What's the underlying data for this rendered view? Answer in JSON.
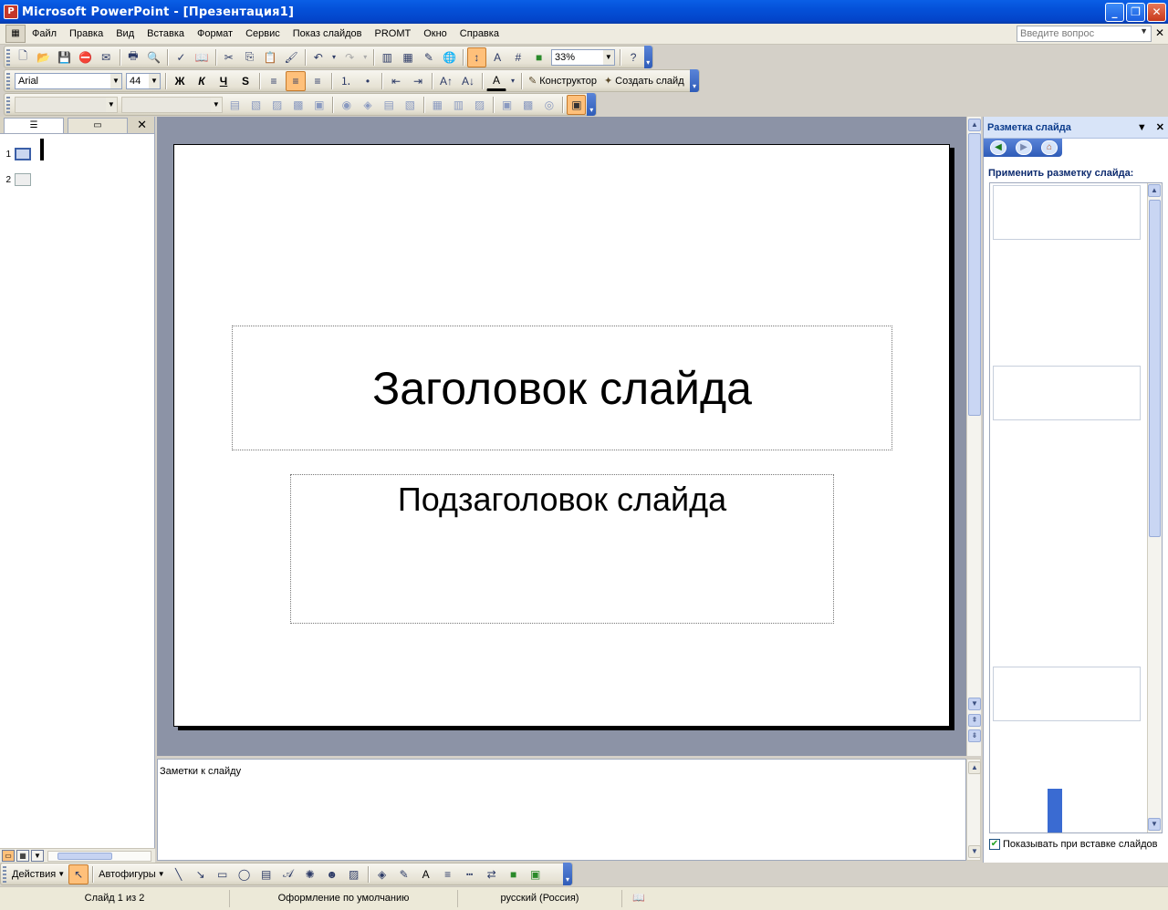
{
  "window": {
    "title": "Microsoft PowerPoint - [Презентация1]"
  },
  "menubar": {
    "items": [
      "Файл",
      "Правка",
      "Вид",
      "Вставка",
      "Формат",
      "Сервис",
      "Показ слайдов",
      "PROMT",
      "Окно",
      "Справка"
    ],
    "ask_placeholder": "Введите вопрос"
  },
  "toolbar_standard": {
    "zoom": "33%"
  },
  "toolbar_formatting": {
    "font": "Arial",
    "size": "44",
    "bold": "Ж",
    "italic": "К",
    "underline": "Ч",
    "shadow": "S",
    "designer_label": "Конструктор",
    "new_slide_label": "Создать слайд"
  },
  "slide": {
    "title": "Заголовок слайда",
    "subtitle": "Подзаголовок слайда"
  },
  "thumbnails": [
    {
      "num": "1"
    },
    {
      "num": "2"
    }
  ],
  "notes": {
    "placeholder": "Заметки к слайду"
  },
  "taskpane": {
    "title": "Разметка слайда",
    "apply_label": "Применить разметку слайда:",
    "show_on_insert": "Показывать при вставке слайдов"
  },
  "drawing_toolbar": {
    "actions": "Действия",
    "autoshapes": "Автофигуры"
  },
  "statusbar": {
    "slide_info": "Слайд 1 из 2",
    "design": "Оформление по умолчанию",
    "language": "русский (Россия)"
  },
  "colors": {
    "titlebar": "#0450d8",
    "slide_bg": "#8c93a6",
    "active_button": "#ffc07a"
  }
}
